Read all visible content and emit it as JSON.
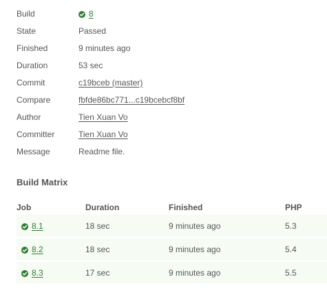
{
  "summary": {
    "build": {
      "label": "Build",
      "value": "8"
    },
    "state": {
      "label": "State",
      "value": "Passed"
    },
    "finished": {
      "label": "Finished",
      "value": "9 minutes ago"
    },
    "duration": {
      "label": "Duration",
      "value": "53 sec"
    },
    "commit": {
      "label": "Commit",
      "value": "c19bceb (master)"
    },
    "compare": {
      "label": "Compare",
      "value": "fbfde86bc771...c19bcebcf8bf"
    },
    "author": {
      "label": "Author",
      "value": "Tien Xuan Vo"
    },
    "committer": {
      "label": "Committer",
      "value": "Tien Xuan Vo"
    },
    "message": {
      "label": "Message",
      "value": "Readme file."
    }
  },
  "matrix": {
    "title": "Build Matrix",
    "headers": {
      "job": "Job",
      "duration": "Duration",
      "finished": "Finished",
      "php": "PHP"
    },
    "rows": [
      {
        "job": "8.1",
        "duration": "18 sec",
        "finished": "9 minutes ago",
        "php": "5.3"
      },
      {
        "job": "8.2",
        "duration": "18 sec",
        "finished": "9 minutes ago",
        "php": "5.4"
      },
      {
        "job": "8.3",
        "duration": "17 sec",
        "finished": "9 minutes ago",
        "php": "5.5"
      }
    ]
  },
  "icons": {
    "status": "check-circle-icon"
  },
  "colors": {
    "passed": "#2e7d32",
    "row_background": "#f6fbf4",
    "text": "#555555"
  }
}
